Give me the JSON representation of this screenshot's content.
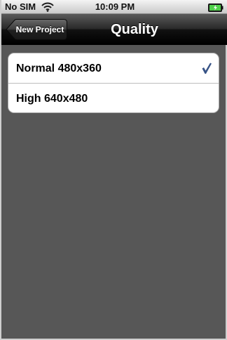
{
  "status_bar": {
    "carrier": "No SIM",
    "time": "10:09 PM",
    "wifi_icon": "wifi-icon",
    "battery_icon": "battery-charging-icon"
  },
  "nav_bar": {
    "back_label": "New Project",
    "title": "Quality"
  },
  "quality_options": [
    {
      "label": "Normal 480x360",
      "selected": true
    },
    {
      "label": "High 640x480",
      "selected": false
    }
  ],
  "colors": {
    "background": "#575757",
    "checkmark": "#385487",
    "nav_bar": "#000000"
  }
}
